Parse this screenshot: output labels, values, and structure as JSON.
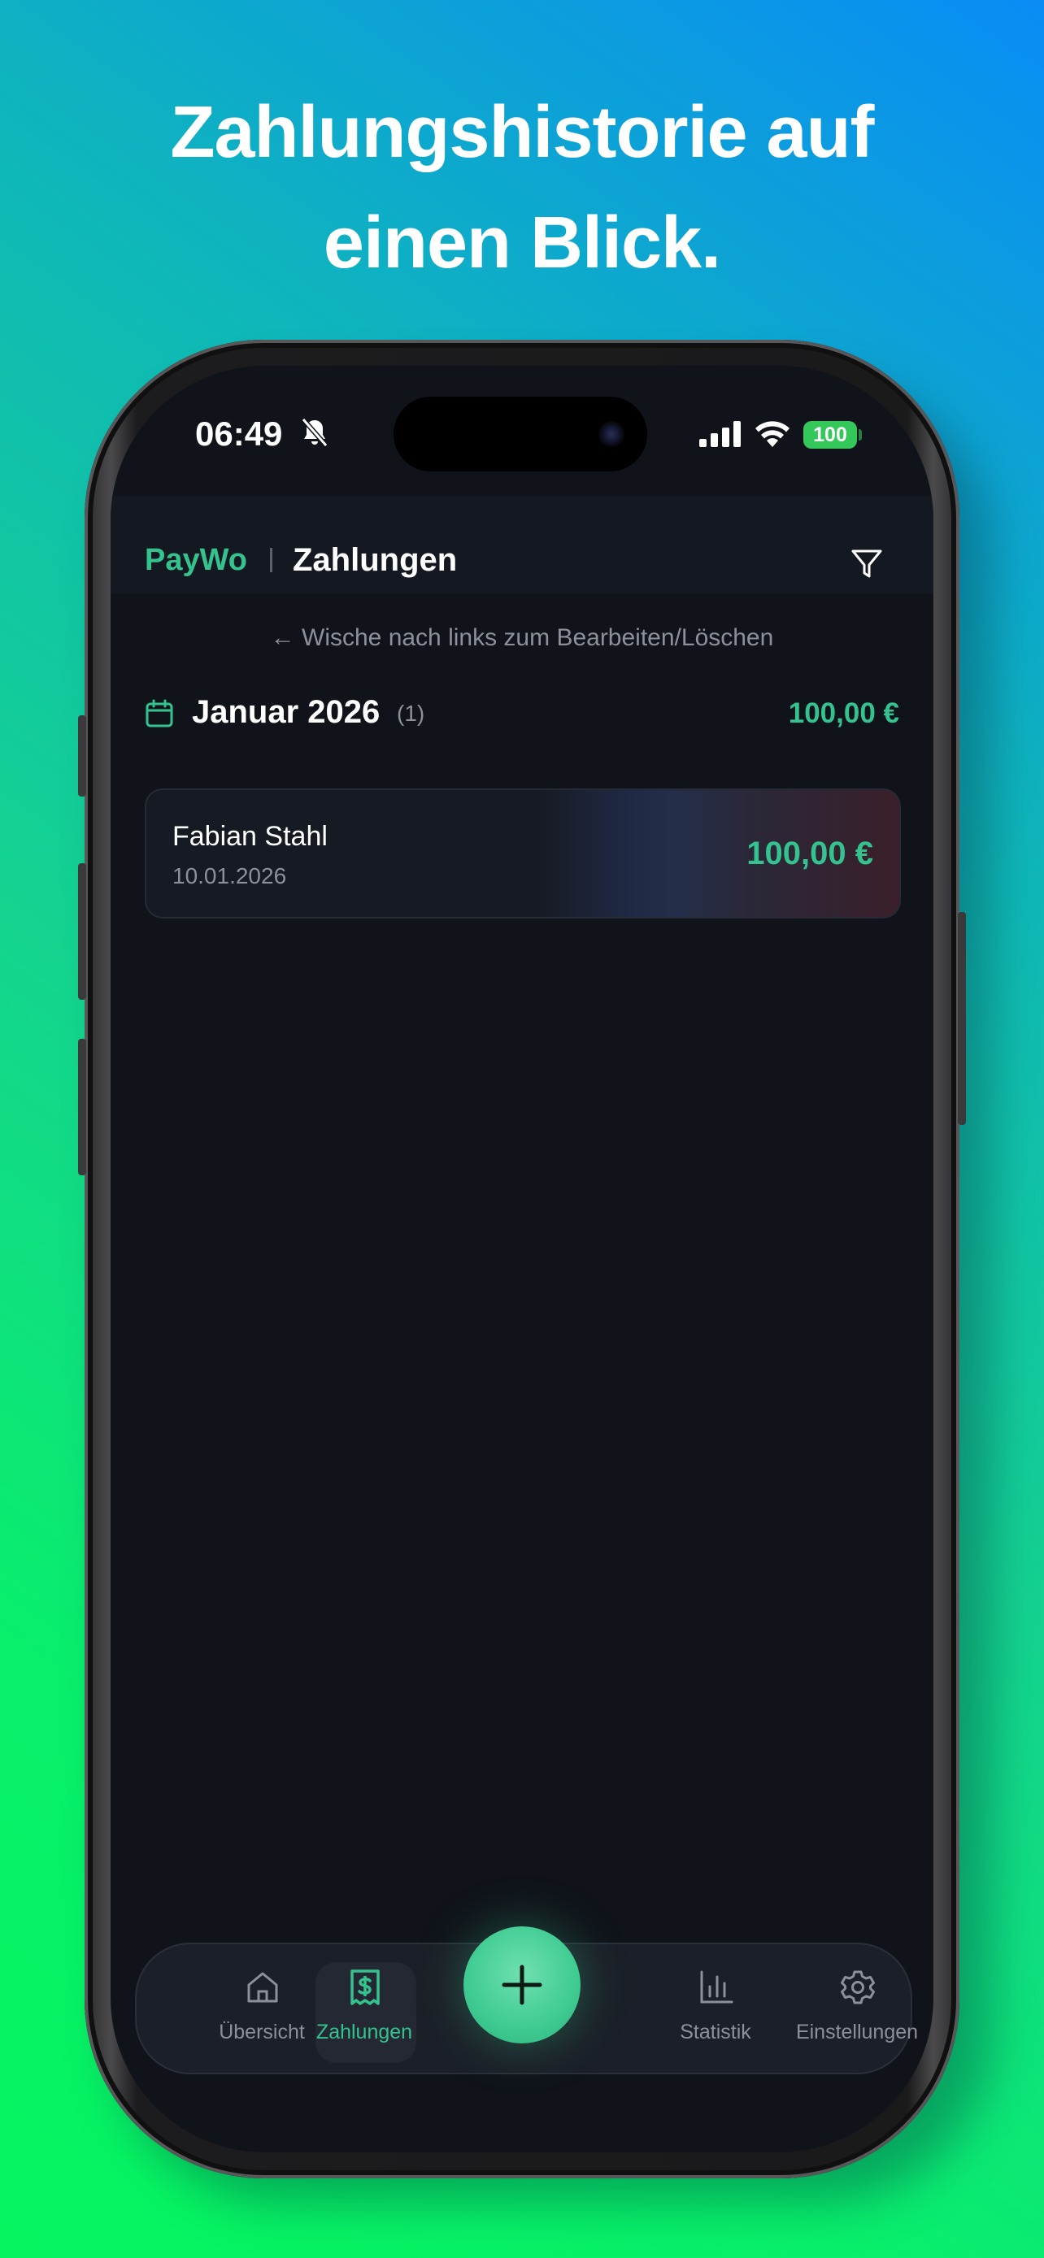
{
  "promo": {
    "headline_line1": "Zahlungshistorie auf",
    "headline_line2": "einen Blick."
  },
  "status_bar": {
    "time": "06:49",
    "battery": "100"
  },
  "app_bar": {
    "brand": "PayWo",
    "title": "Zahlungen"
  },
  "hint": "← Wische nach links zum Bearbeiten/Löschen",
  "month_group": {
    "label": "Januar 2026",
    "count": "(1)",
    "total": "100,00 €"
  },
  "payments": [
    {
      "name": "Fabian Stahl",
      "date": "10.01.2026",
      "amount": "100,00 €"
    }
  ],
  "tabs": [
    {
      "label": "Übersicht",
      "icon": "home-icon"
    },
    {
      "label": "Zahlungen",
      "icon": "receipt-icon",
      "active": true
    },
    {
      "label": "Statistik",
      "icon": "bar-chart-icon"
    },
    {
      "label": "Einstellungen",
      "icon": "gear-icon"
    }
  ],
  "colors": {
    "accent": "#34c38f",
    "background": "#10131a",
    "surface": "#1b1f27"
  }
}
